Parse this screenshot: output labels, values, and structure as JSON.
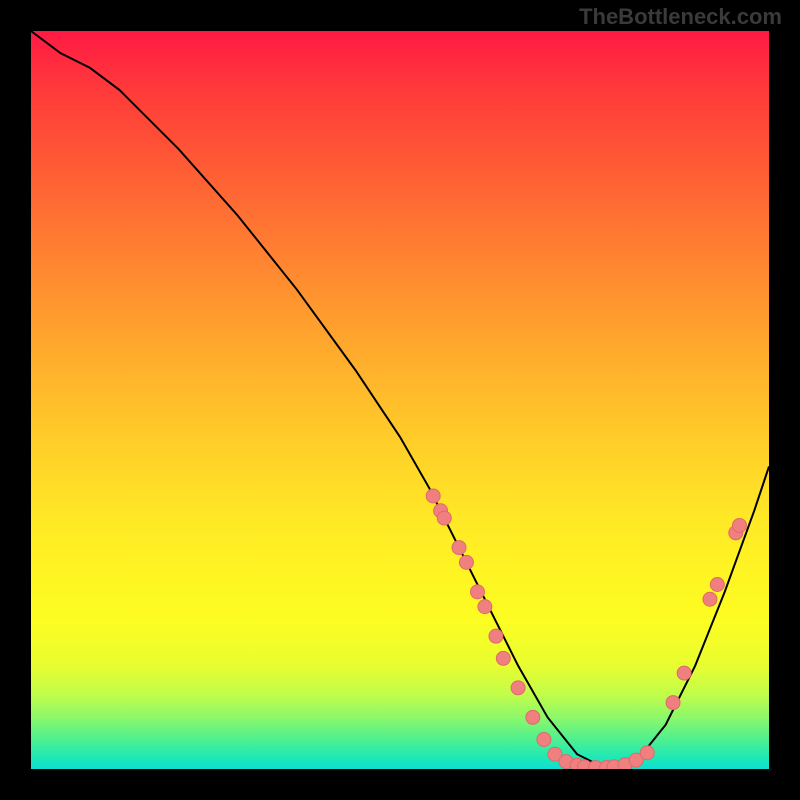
{
  "watermark": "TheBottleneck.com",
  "chart_data": {
    "type": "line",
    "title": "",
    "xlabel": "",
    "ylabel": "",
    "xlim": [
      0,
      100
    ],
    "ylim": [
      0,
      100
    ],
    "grid": false,
    "legend": false,
    "line": {
      "x": [
        0,
        4,
        8,
        12,
        20,
        28,
        36,
        44,
        50,
        54,
        58,
        62,
        66,
        70,
        74,
        78,
        82,
        86,
        90,
        94,
        98,
        100
      ],
      "y": [
        100,
        97,
        95,
        92,
        84,
        75,
        65,
        54,
        45,
        38,
        30,
        22,
        14,
        7,
        2,
        0,
        1,
        6,
        14,
        24,
        35,
        41
      ]
    },
    "markers": [
      {
        "x": 54.5,
        "y": 37
      },
      {
        "x": 55.5,
        "y": 35
      },
      {
        "x": 56.0,
        "y": 34
      },
      {
        "x": 58.0,
        "y": 30
      },
      {
        "x": 59.0,
        "y": 28
      },
      {
        "x": 60.5,
        "y": 24
      },
      {
        "x": 61.5,
        "y": 22
      },
      {
        "x": 63.0,
        "y": 18
      },
      {
        "x": 64.0,
        "y": 15
      },
      {
        "x": 66.0,
        "y": 11
      },
      {
        "x": 68.0,
        "y": 7
      },
      {
        "x": 69.5,
        "y": 4
      },
      {
        "x": 71.0,
        "y": 2
      },
      {
        "x": 72.5,
        "y": 1
      },
      {
        "x": 74.0,
        "y": 0.5
      },
      {
        "x": 75.0,
        "y": 0.3
      },
      {
        "x": 76.5,
        "y": 0.2
      },
      {
        "x": 78.0,
        "y": 0.2
      },
      {
        "x": 79.0,
        "y": 0.3
      },
      {
        "x": 80.5,
        "y": 0.6
      },
      {
        "x": 82.0,
        "y": 1.2
      },
      {
        "x": 83.5,
        "y": 2.2
      },
      {
        "x": 87.0,
        "y": 9
      },
      {
        "x": 88.5,
        "y": 13
      },
      {
        "x": 92.0,
        "y": 23
      },
      {
        "x": 93.0,
        "y": 25
      },
      {
        "x": 95.5,
        "y": 32
      },
      {
        "x": 96.0,
        "y": 33
      }
    ],
    "marker_style": {
      "fill": "#f08080",
      "stroke": "#e06868",
      "radius": 7
    },
    "gradient_stops": [
      {
        "pos": 0,
        "color": "#ff1a44"
      },
      {
        "pos": 50,
        "color": "#ffd428"
      },
      {
        "pos": 100,
        "color": "#0fe0d2"
      }
    ]
  }
}
